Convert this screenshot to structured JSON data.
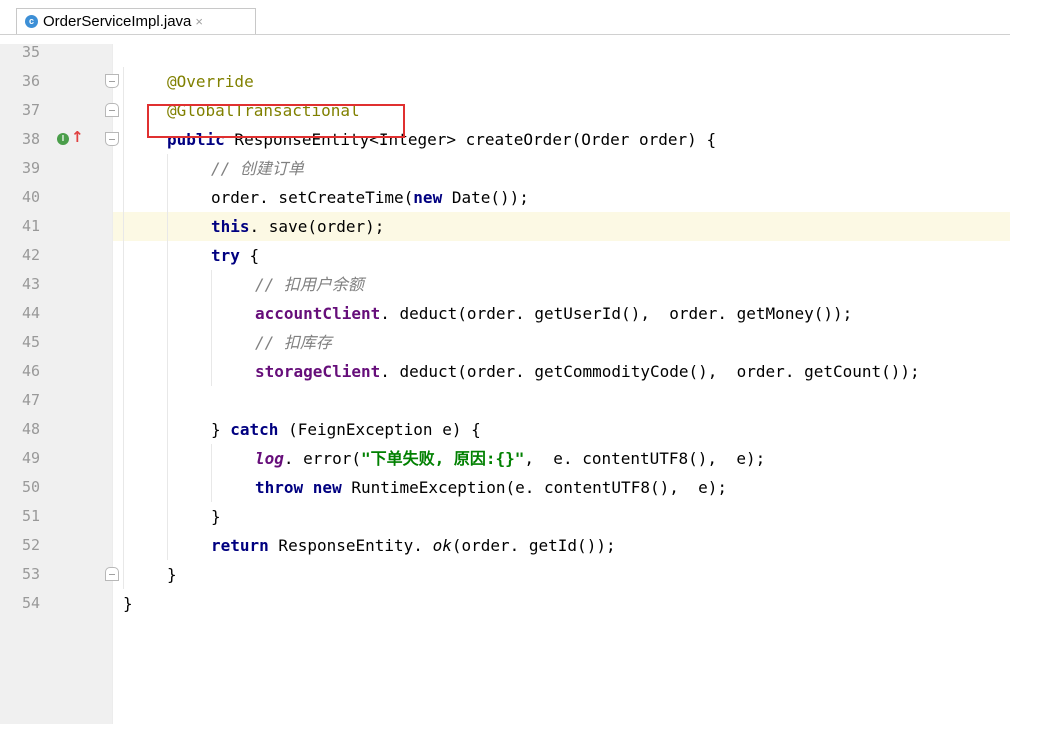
{
  "tab": {
    "icon_letter": "c",
    "filename": "OrderServiceImpl.java",
    "close": "×"
  },
  "gutter_markers": {
    "implements_letter": "I",
    "arrow": "↑"
  },
  "lines": [
    {
      "n": "35"
    },
    {
      "n": "36",
      "t0": "@Override"
    },
    {
      "n": "37",
      "t0": "@GlobalTransactional"
    },
    {
      "n": "38",
      "t0": "public",
      "t1": " ResponseEntity<Integer> createOrder(Order order) {"
    },
    {
      "n": "39",
      "t0": "// 创建订单"
    },
    {
      "n": "40",
      "t0": "order. setCreateTime(",
      "t1": "new",
      "t2": " Date());"
    },
    {
      "n": "41",
      "t0": "this",
      "t1": ". save(order);"
    },
    {
      "n": "42",
      "t0": "try",
      "t1": " {"
    },
    {
      "n": "43",
      "t0": "// 扣用户余额"
    },
    {
      "n": "44",
      "t0": "accountClient",
      "t1": ". deduct(order. getUserId(),  order. getMoney());"
    },
    {
      "n": "45",
      "t0": "// 扣库存"
    },
    {
      "n": "46",
      "t0": "storageClient",
      "t1": ". deduct(order. getCommodityCode(),  order. getCount());"
    },
    {
      "n": "47"
    },
    {
      "n": "48",
      "t0": "} ",
      "t1": "catch",
      "t2": " (FeignException e) {"
    },
    {
      "n": "49",
      "t0": "log",
      "t1": ". error(",
      "t2": "\"下单失败, 原因:{}\"",
      "t3": ",  e. contentUTF8(),  e);"
    },
    {
      "n": "50",
      "t0": "throw new",
      "t1": " RuntimeException(e. contentUTF8(),  e);"
    },
    {
      "n": "51",
      "t0": "}"
    },
    {
      "n": "52",
      "t0": "return",
      "t1": " ResponseEntity. ",
      "t2": "ok",
      "t3": "(order. getId());"
    },
    {
      "n": "53",
      "t0": "}"
    },
    {
      "n": "54",
      "t0": "}"
    }
  ]
}
